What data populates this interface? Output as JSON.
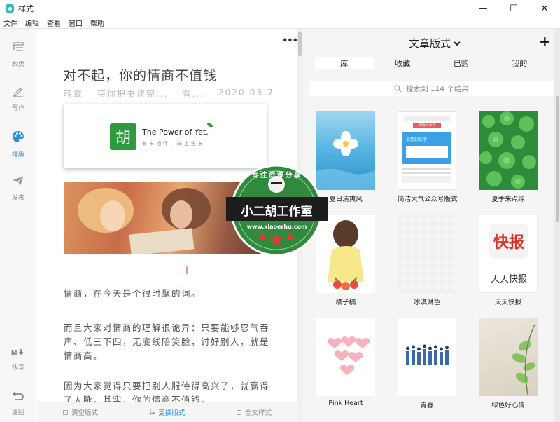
{
  "window": {
    "title": "样式",
    "controls": [
      "—",
      "☐",
      "✕"
    ]
  },
  "menu": [
    "文件",
    "编辑",
    "查看",
    "窗口",
    "帮助"
  ],
  "sidebar": {
    "items": [
      {
        "label": "构思",
        "icon": "outline-icon"
      },
      {
        "label": "写作",
        "icon": "pen-icon"
      },
      {
        "label": "排版",
        "icon": "palette-icon",
        "active": true
      },
      {
        "label": "发表",
        "icon": "paper-plane-icon"
      },
      {
        "label": "快写",
        "icon": "markdown-icon"
      },
      {
        "label": "返回",
        "icon": "back-arrow-icon"
      }
    ]
  },
  "editor": {
    "more": "•••",
    "title": "对不起，你的情商不值钱",
    "meta": {
      "source": "转载",
      "author": "带你把书读完...",
      "extra": "有...",
      "date": "2020-03-7"
    },
    "banner": {
      "logo_char": "胡",
      "main": "The Power of Yet.",
      "sub": "有书相伴，向上生长"
    },
    "paragraphs": [
      "情商，在今天是个很时髦的词。",
      "而且大家对情商的理解很诡异：只要能够忍气吞声、低三下四，无底线陪笑脸，讨好别人，就是情商高。",
      "因为大家觉得只要把别人服侍得高兴了，就赢得了人脉。其实，你的情商不值钱。"
    ],
    "footer": {
      "clear": "清空版式",
      "replace": "更换版式",
      "full": "全文样式"
    }
  },
  "panel": {
    "title": "文章版式",
    "plus": "+",
    "tabs": [
      "库",
      "收藏",
      "已购",
      "我的"
    ],
    "active_tab": "库",
    "search_placeholder": "搜索到 114 个结果",
    "cards": [
      {
        "name": "夏日清爽风"
      },
      {
        "name": "简洁大气公众号版式"
      },
      {
        "name": "夏季来点绿"
      },
      {
        "name": "橘子橘"
      },
      {
        "name": "冰淇淋色"
      },
      {
        "name": "天天快报"
      },
      {
        "name": "Pink Heart"
      },
      {
        "name": "青春"
      },
      {
        "name": "绿色好心情"
      }
    ],
    "card_texts": {
      "wechat_header": "稿纸公众号",
      "wechat_body": "灵感刻文字",
      "kuaibao_big": "快报",
      "kuaibao_small": "天天快报"
    }
  },
  "watermark": {
    "top": "专注资源分享",
    "main": "小二胡工作室",
    "url": "www.xiaoerhu.com"
  },
  "colors": {
    "accent": "#2f8ed9",
    "panel_bg": "#f5f5f5",
    "sidebar_bg": "#f7f7f7"
  }
}
